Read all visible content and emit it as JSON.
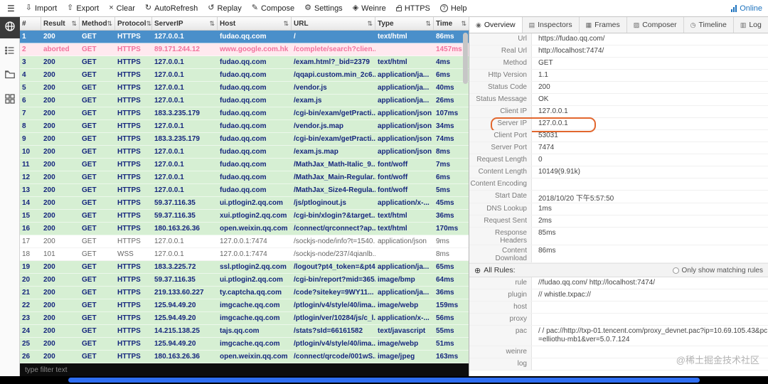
{
  "toolbar": {
    "menu_icon": "menu-icon",
    "items": [
      {
        "label": "Import",
        "icon": "import-icon"
      },
      {
        "label": "Export",
        "icon": "export-icon"
      },
      {
        "label": "Clear",
        "icon": "clear-icon"
      },
      {
        "label": "AutoRefresh",
        "icon": "autorefresh-icon"
      },
      {
        "label": "Replay",
        "icon": "replay-icon"
      },
      {
        "label": "Compose",
        "icon": "compose-icon"
      },
      {
        "label": "Settings",
        "icon": "settings-icon"
      },
      {
        "label": "Weinre",
        "icon": "weinre-icon"
      },
      {
        "label": "HTTPS",
        "icon": "https-icon"
      },
      {
        "label": "Help",
        "icon": "help-icon"
      }
    ],
    "online_label": "Online",
    "online_icon": "signal-icon"
  },
  "sidebar": {
    "items": [
      {
        "name": "network",
        "icon": "network-icon",
        "active": true
      },
      {
        "name": "rules",
        "icon": "rules-icon",
        "active": false
      },
      {
        "name": "values",
        "icon": "values-icon",
        "active": false
      },
      {
        "name": "plugins",
        "icon": "plugins-icon",
        "active": false
      }
    ]
  },
  "table": {
    "columns": [
      "#",
      "Result",
      "Method",
      "Protocol",
      "ServerIP",
      "Host",
      "URL",
      "Type",
      "Time"
    ],
    "rows": [
      {
        "id": "1",
        "result": "200",
        "method": "GET",
        "protocol": "HTTPS",
        "server_ip": "127.0.0.1",
        "host": "fudao.qq.com",
        "url": "/",
        "type": "text/html",
        "time": "86ms",
        "state": "selected"
      },
      {
        "id": "2",
        "result": "aborted",
        "method": "GET",
        "protocol": "HTTPS",
        "server_ip": "89.171.244.12",
        "host": "www.google.com.hk",
        "url": "/complete/search?clien...",
        "type": "",
        "time": "1457ms",
        "state": "aborted"
      },
      {
        "id": "3",
        "result": "200",
        "method": "GET",
        "protocol": "HTTPS",
        "server_ip": "127.0.0.1",
        "host": "fudao.qq.com",
        "url": "/exam.html?_bid=2379",
        "type": "text/html",
        "time": "4ms",
        "state": "success"
      },
      {
        "id": "4",
        "result": "200",
        "method": "GET",
        "protocol": "HTTPS",
        "server_ip": "127.0.0.1",
        "host": "fudao.qq.com",
        "url": "/qqapi.custom.min_2c6...",
        "type": "application/ja...",
        "time": "6ms",
        "state": "success"
      },
      {
        "id": "5",
        "result": "200",
        "method": "GET",
        "protocol": "HTTPS",
        "server_ip": "127.0.0.1",
        "host": "fudao.qq.com",
        "url": "/vendor.js",
        "type": "application/ja...",
        "time": "40ms",
        "state": "success"
      },
      {
        "id": "6",
        "result": "200",
        "method": "GET",
        "protocol": "HTTPS",
        "server_ip": "127.0.0.1",
        "host": "fudao.qq.com",
        "url": "/exam.js",
        "type": "application/ja...",
        "time": "26ms",
        "state": "success"
      },
      {
        "id": "7",
        "result": "200",
        "method": "GET",
        "protocol": "HTTPS",
        "server_ip": "183.3.235.179",
        "host": "fudao.qq.com",
        "url": "/cgi-bin/exam/getPracti...",
        "type": "application/json",
        "time": "107ms",
        "state": "success"
      },
      {
        "id": "8",
        "result": "200",
        "method": "GET",
        "protocol": "HTTPS",
        "server_ip": "127.0.0.1",
        "host": "fudao.qq.com",
        "url": "/vendor.js.map",
        "type": "application/json",
        "time": "34ms",
        "state": "success"
      },
      {
        "id": "9",
        "result": "200",
        "method": "GET",
        "protocol": "HTTPS",
        "server_ip": "183.3.235.179",
        "host": "fudao.qq.com",
        "url": "/cgi-bin/exam/getPracti...",
        "type": "application/json",
        "time": "74ms",
        "state": "success"
      },
      {
        "id": "10",
        "result": "200",
        "method": "GET",
        "protocol": "HTTPS",
        "server_ip": "127.0.0.1",
        "host": "fudao.qq.com",
        "url": "/exam.js.map",
        "type": "application/json",
        "time": "8ms",
        "state": "success"
      },
      {
        "id": "11",
        "result": "200",
        "method": "GET",
        "protocol": "HTTPS",
        "server_ip": "127.0.0.1",
        "host": "fudao.qq.com",
        "url": "/MathJax_Math-Italic_9...",
        "type": "font/woff",
        "time": "7ms",
        "state": "success"
      },
      {
        "id": "12",
        "result": "200",
        "method": "GET",
        "protocol": "HTTPS",
        "server_ip": "127.0.0.1",
        "host": "fudao.qq.com",
        "url": "/MathJax_Main-Regular...",
        "type": "font/woff",
        "time": "6ms",
        "state": "success"
      },
      {
        "id": "13",
        "result": "200",
        "method": "GET",
        "protocol": "HTTPS",
        "server_ip": "127.0.0.1",
        "host": "fudao.qq.com",
        "url": "/MathJax_Size4-Regula...",
        "type": "font/woff",
        "time": "5ms",
        "state": "success"
      },
      {
        "id": "14",
        "result": "200",
        "method": "GET",
        "protocol": "HTTPS",
        "server_ip": "59.37.116.35",
        "host": "ui.ptlogin2.qq.com",
        "url": "/js/ptloginout.js",
        "type": "application/x-...",
        "time": "45ms",
        "state": "success"
      },
      {
        "id": "15",
        "result": "200",
        "method": "GET",
        "protocol": "HTTPS",
        "server_ip": "59.37.116.35",
        "host": "xui.ptlogin2.qq.com",
        "url": "/cgi-bin/xlogin?&target...",
        "type": "text/html",
        "time": "36ms",
        "state": "success"
      },
      {
        "id": "16",
        "result": "200",
        "method": "GET",
        "protocol": "HTTPS",
        "server_ip": "180.163.26.36",
        "host": "open.weixin.qq.com",
        "url": "/connect/qrconnect?ap...",
        "type": "text/html",
        "time": "170ms",
        "state": "success"
      },
      {
        "id": "17",
        "result": "200",
        "method": "GET",
        "protocol": "HTTPS",
        "server_ip": "127.0.0.1",
        "host": "127.0.0.1:7474",
        "url": "/sockjs-node/info?t=1540...",
        "type": "application/json",
        "time": "9ms",
        "state": "plain"
      },
      {
        "id": "18",
        "result": "101",
        "method": "GET",
        "protocol": "WSS",
        "server_ip": "127.0.0.1",
        "host": "127.0.0.1:7474",
        "url": "/sockjs-node/237/4qianlb...",
        "type": "",
        "time": "8ms",
        "state": "plain"
      },
      {
        "id": "19",
        "result": "200",
        "method": "GET",
        "protocol": "HTTPS",
        "server_ip": "183.3.225.72",
        "host": "ssl.ptlogin2.qq.com",
        "url": "/logout?pt4_token=&pt4...",
        "type": "application/ja...",
        "time": "65ms",
        "state": "success"
      },
      {
        "id": "20",
        "result": "200",
        "method": "GET",
        "protocol": "HTTPS",
        "server_ip": "59.37.116.35",
        "host": "ui.ptlogin2.qq.com",
        "url": "/cgi-bin/report?mid=365...",
        "type": "image/bmp",
        "time": "64ms",
        "state": "success"
      },
      {
        "id": "21",
        "result": "200",
        "method": "GET",
        "protocol": "HTTPS",
        "server_ip": "219.133.60.227",
        "host": "ty.captcha.qq.com",
        "url": "/code?sitekey=9WY11...",
        "type": "application/ja...",
        "time": "36ms",
        "state": "success"
      },
      {
        "id": "22",
        "result": "200",
        "method": "GET",
        "protocol": "HTTPS",
        "server_ip": "125.94.49.20",
        "host": "imgcache.qq.com",
        "url": "/ptlogin/v4/style/40/ima...",
        "type": "image/webp",
        "time": "159ms",
        "state": "success"
      },
      {
        "id": "23",
        "result": "200",
        "method": "GET",
        "protocol": "HTTPS",
        "server_ip": "125.94.49.20",
        "host": "imgcache.qq.com",
        "url": "/ptlogin/ver/10284/js/c_l...",
        "type": "application/x-...",
        "time": "56ms",
        "state": "success"
      },
      {
        "id": "24",
        "result": "200",
        "method": "GET",
        "protocol": "HTTPS",
        "server_ip": "14.215.138.25",
        "host": "tajs.qq.com",
        "url": "/stats?sId=66161582",
        "type": "text/javascript",
        "time": "55ms",
        "state": "success"
      },
      {
        "id": "25",
        "result": "200",
        "method": "GET",
        "protocol": "HTTPS",
        "server_ip": "125.94.49.20",
        "host": "imgcache.qq.com",
        "url": "/ptlogin/v4/style/40/ima...",
        "type": "image/webp",
        "time": "51ms",
        "state": "success"
      },
      {
        "id": "26",
        "result": "200",
        "method": "GET",
        "protocol": "HTTPS",
        "server_ip": "180.163.26.36",
        "host": "open.weixin.qq.com",
        "url": "/connect/qrcode/001wS...",
        "type": "image/jpeg",
        "time": "163ms",
        "state": "success"
      }
    ]
  },
  "filter_placeholder": "type filter text",
  "tabs": [
    {
      "label": "Overview",
      "icon": "overview-icon",
      "active": true
    },
    {
      "label": "Inspectors",
      "icon": "inspectors-icon",
      "active": false
    },
    {
      "label": "Frames",
      "icon": "frames-icon",
      "active": false
    },
    {
      "label": "Composer",
      "icon": "composer-icon",
      "active": false
    },
    {
      "label": "Timeline",
      "icon": "timeline-icon",
      "active": false
    },
    {
      "label": "Log",
      "icon": "log-icon",
      "active": false
    }
  ],
  "overview": {
    "fields": [
      {
        "label": "Url",
        "value": "https://fudao.qq.com/"
      },
      {
        "label": "Real Url",
        "value": "http://localhost:7474/"
      },
      {
        "label": "Method",
        "value": "GET"
      },
      {
        "label": "Http Version",
        "value": "1.1"
      },
      {
        "label": "Status Code",
        "value": "200"
      },
      {
        "label": "Status Message",
        "value": "OK"
      },
      {
        "label": "Client IP",
        "value": "127.0.0.1"
      },
      {
        "label": "Server IP",
        "value": "127.0.0.1",
        "highlighted": true
      },
      {
        "label": "Client Port",
        "value": "53031"
      },
      {
        "label": "Server Port",
        "value": "7474"
      },
      {
        "label": "Request Length",
        "value": "0"
      },
      {
        "label": "Content Length",
        "value": "10149(9.91k)"
      },
      {
        "label": "Content Encoding",
        "value": ""
      },
      {
        "label": "Start Date",
        "value": "2018/10/20 下午5:57:50"
      },
      {
        "label": "DNS Lookup",
        "value": "1ms"
      },
      {
        "label": "Request Sent",
        "value": "2ms"
      },
      {
        "label": "Response Headers",
        "value": "85ms"
      },
      {
        "label": "Content Download",
        "value": "86ms"
      }
    ]
  },
  "rules": {
    "header": "All Rules:",
    "filter_label": "Only show matching rules",
    "fields": [
      {
        "label": "rule",
        "value": "//fudao.qq.com/ http://localhost:7474/"
      },
      {
        "label": "plugin",
        "value": "// whistle.txpac://"
      },
      {
        "label": "host",
        "value": ""
      },
      {
        "label": "proxy",
        "value": ""
      },
      {
        "label": "pac",
        "value": "/ / pac://http://txp-01.tencent.com/proxy_devnet.pac?ip=10.69.105.43&pc=elliothu-mb1&ver=5.0.7.124"
      },
      {
        "label": "weinre",
        "value": ""
      },
      {
        "label": "log",
        "value": ""
      }
    ]
  },
  "watermark": "@稀土掘金技术社区",
  "colors": {
    "selected_row": "#4a8fca",
    "success_row": "#d6efd3",
    "aborted_row": "#ffe9ef",
    "aborted_text": "#f2719c",
    "highlight_border": "#e2672e",
    "online_blue": "#1e73be"
  }
}
